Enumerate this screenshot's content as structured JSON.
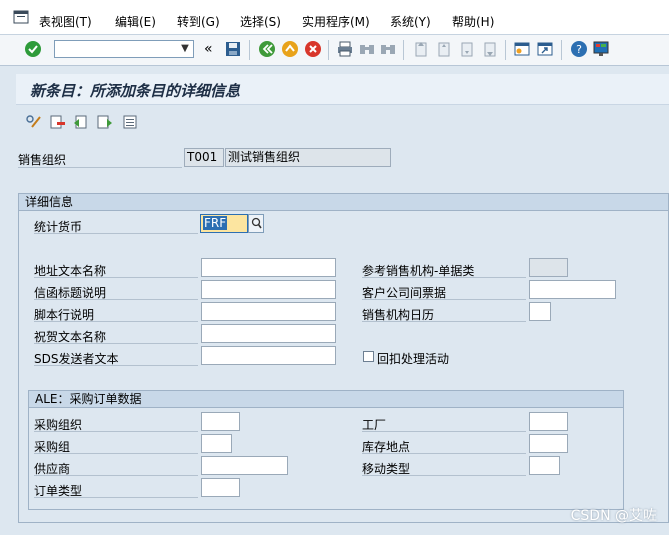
{
  "menu": {
    "items": [
      "表视图(T)",
      "编辑(E)",
      "转到(G)",
      "选择(S)",
      "实用程序(M)",
      "系统(Y)",
      "帮助(H)"
    ]
  },
  "toolbar": {
    "command_value": "",
    "nav_symbol": "«"
  },
  "page": {
    "title": "新条目：所添加条目的详细信息"
  },
  "header_fields": {
    "sales_org_label": "销售组织",
    "sales_org_code": "T001",
    "sales_org_name": "测试销售组织"
  },
  "details": {
    "group_title": "详细信息",
    "currency_label": "统计货币",
    "currency_value": "FRF",
    "left_labels": [
      "地址文本名称",
      "信函标题说明",
      "脚本行说明",
      "祝贺文本名称",
      "SDS发送者文本"
    ],
    "right_labels": [
      "参考销售机构-单据类",
      "客户公司间票据",
      "销售机构日历"
    ],
    "checkbox_label": "回扣处理活动"
  },
  "ale": {
    "group_title": "ALE：采购订单数据",
    "left_labels": [
      "采购组织",
      "采购组",
      "供应商",
      "订单类型"
    ],
    "right_labels": [
      "工厂",
      "库存地点",
      "移动类型"
    ]
  },
  "watermark": "CSDN @艾咗",
  "colors": {
    "background": "#dde7f0",
    "title_text": "#1e2f46",
    "enter_icon": "#2e9b3a",
    "cancel_icon": "#d8362b"
  }
}
